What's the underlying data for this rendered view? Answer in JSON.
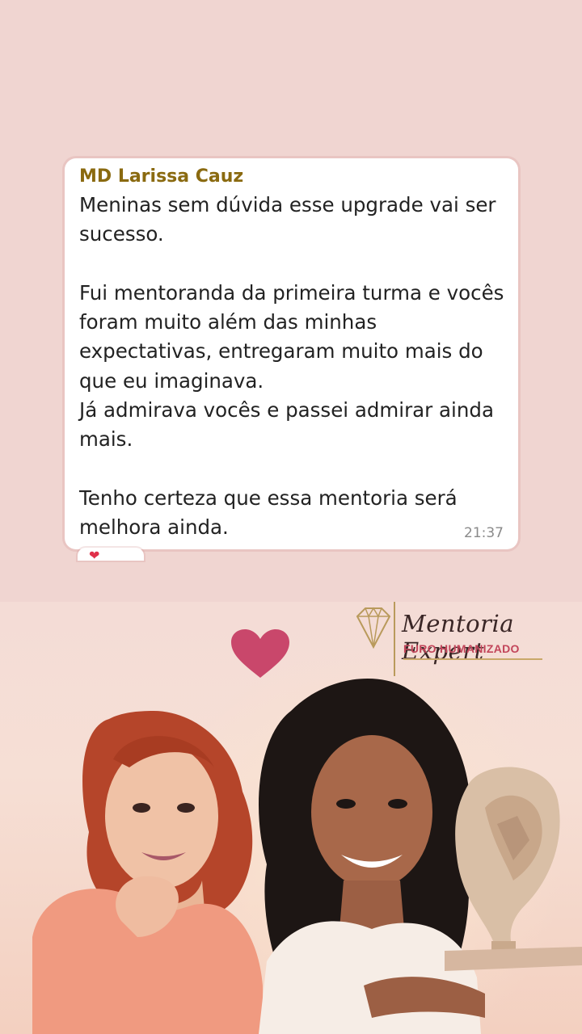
{
  "message": {
    "sender": "MD Larissa Cauz",
    "text": "Meninas sem dúvida esse upgrade vai ser sucesso.\n\nFui mentoranda da primeira turma e vocês foram muito além das minhas expectativas, entregaram muito mais do que eu imaginava.\nJá admirava vocês e passei admirar ainda mais.\n\nTenho certeza que essa mentoria será melhora ainda.",
    "time": "21:37",
    "reaction": "❤"
  },
  "banner": {
    "logo_title": "Mentoria Expert",
    "logo_subtitle": "FURO HUMANIZADO"
  },
  "colors": {
    "background": "#f0d5d1",
    "sender": "#8a6a10",
    "heart": "#c9476b",
    "logo_gold": "#b99a5c",
    "logo_red": "#c2455a"
  },
  "icons": [
    "heart-icon",
    "diamond-logo-icon"
  ]
}
